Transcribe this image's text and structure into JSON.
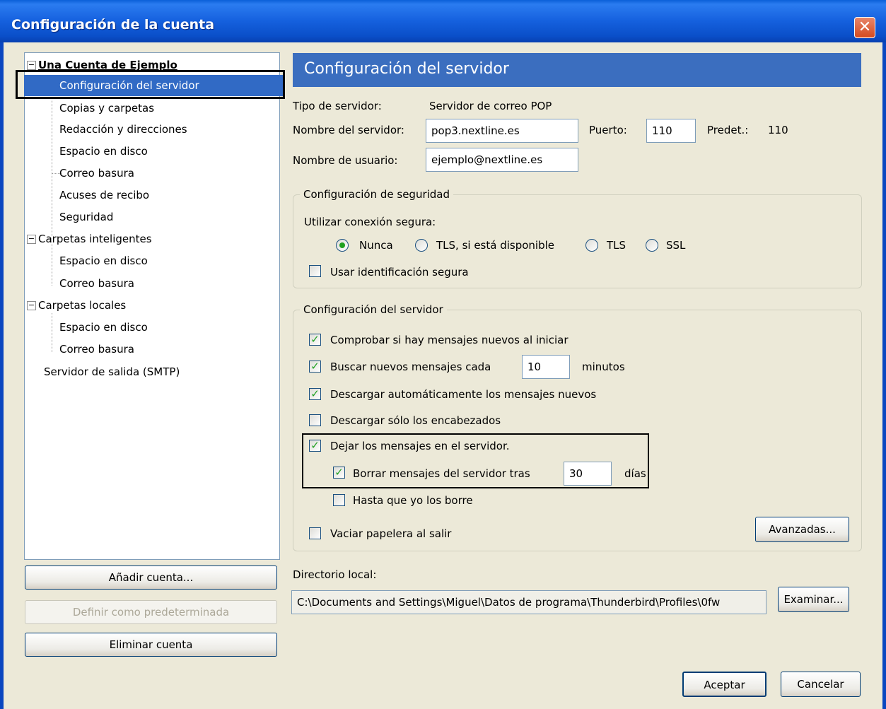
{
  "window": {
    "title": "Configuración de la cuenta",
    "close_glyph": "✕"
  },
  "tree": {
    "account": "Una Cuenta de Ejemplo",
    "account_items": [
      "Configuración del servidor",
      "Copias y carpetas",
      "Redacción y direcciones",
      "Espacio en disco",
      "Correo basura",
      "Acuses de recibo",
      "Seguridad"
    ],
    "smart": "Carpetas inteligentes",
    "smart_items": [
      "Espacio en disco",
      "Correo basura"
    ],
    "local": "Carpetas locales",
    "local_items": [
      "Espacio en disco",
      "Correo basura"
    ],
    "smtp": "Servidor de salida (SMTP)"
  },
  "left_buttons": {
    "add_account": "Añadir cuenta...",
    "set_default": "Definir como predeterminada",
    "remove_account": "Eliminar cuenta"
  },
  "panel": {
    "header": "Configuración del servidor",
    "server_type_label": "Tipo de servidor:",
    "server_type_value": "Servidor de correo POP",
    "server_name_label": "Nombre del servidor:",
    "server_name_value": "pop3.nextline.es",
    "port_label": "Puerto:",
    "port_value": "110",
    "default_label": "Predet.:",
    "default_value": "110",
    "user_label": "Nombre de usuario:",
    "user_value": "ejemplo@nextline.es"
  },
  "security": {
    "title": "Configuración de seguridad",
    "secure_label": "Utilizar conexión segura:",
    "options": [
      "Nunca",
      "TLS, si está disponible",
      "TLS",
      "SSL"
    ],
    "selected": "Nunca",
    "secure_auth": "Usar identificación segura"
  },
  "server_settings": {
    "title": "Configuración del servidor",
    "check_startup": "Comprobar si hay mensajes nuevos al iniciar",
    "check_every": "Buscar nuevos mensajes cada",
    "check_every_value": "10",
    "minutes": "minutos",
    "auto_download": "Descargar automáticamente los mensajes nuevos",
    "headers_only": "Descargar sólo los encabezados",
    "leave_on_server": "Dejar los mensajes en el servidor.",
    "delete_after": "Borrar mensajes del servidor tras",
    "delete_after_value": "30",
    "days": "días",
    "until_delete": "Hasta que yo los borre",
    "empty_trash": "Vaciar papelera al salir",
    "advanced_button": "Avanzadas..."
  },
  "local_dir": {
    "label": "Directorio local:",
    "value": "C:\\Documents and Settings\\Miguel\\Datos de programa\\Thunderbird\\Profiles\\0fw",
    "browse_button": "Examinar..."
  },
  "footer": {
    "ok": "Aceptar",
    "cancel": "Cancelar"
  }
}
